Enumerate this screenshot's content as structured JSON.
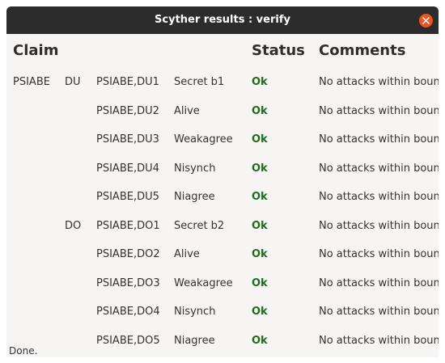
{
  "window": {
    "title": "Scyther results : verify"
  },
  "table": {
    "headers": {
      "claim": "Claim",
      "status": "Status",
      "comments": "Comments"
    },
    "rows": [
      {
        "protocol": "PSIABE",
        "role": "DU",
        "claim_id": "PSIABE,DU1",
        "claim_type": "Secret b1",
        "status": "Ok",
        "comment": "No attacks within bounds."
      },
      {
        "protocol": "",
        "role": "",
        "claim_id": "PSIABE,DU2",
        "claim_type": "Alive",
        "status": "Ok",
        "comment": "No attacks within bounds."
      },
      {
        "protocol": "",
        "role": "",
        "claim_id": "PSIABE,DU3",
        "claim_type": "Weakagree",
        "status": "Ok",
        "comment": "No attacks within bounds."
      },
      {
        "protocol": "",
        "role": "",
        "claim_id": "PSIABE,DU4",
        "claim_type": "Nisynch",
        "status": "Ok",
        "comment": "No attacks within bounds."
      },
      {
        "protocol": "",
        "role": "",
        "claim_id": "PSIABE,DU5",
        "claim_type": "Niagree",
        "status": "Ok",
        "comment": "No attacks within bounds."
      },
      {
        "protocol": "",
        "role": "DO",
        "claim_id": "PSIABE,DO1",
        "claim_type": "Secret b2",
        "status": "Ok",
        "comment": "No attacks within bounds."
      },
      {
        "protocol": "",
        "role": "",
        "claim_id": "PSIABE,DO2",
        "claim_type": "Alive",
        "status": "Ok",
        "comment": "No attacks within bounds."
      },
      {
        "protocol": "",
        "role": "",
        "claim_id": "PSIABE,DO3",
        "claim_type": "Weakagree",
        "status": "Ok",
        "comment": "No attacks within bounds."
      },
      {
        "protocol": "",
        "role": "",
        "claim_id": "PSIABE,DO4",
        "claim_type": "Nisynch",
        "status": "Ok",
        "comment": "No attacks within bounds."
      },
      {
        "protocol": "",
        "role": "",
        "claim_id": "PSIABE,DO5",
        "claim_type": "Niagree",
        "status": "Ok",
        "comment": "No attacks within bounds."
      }
    ]
  },
  "statusbar": {
    "text": "Done."
  },
  "colors": {
    "titlebar": "#2c2c2c",
    "close_button": "#e95420",
    "ok_status": "#1f6b1f",
    "background": "#f6f5f4"
  }
}
